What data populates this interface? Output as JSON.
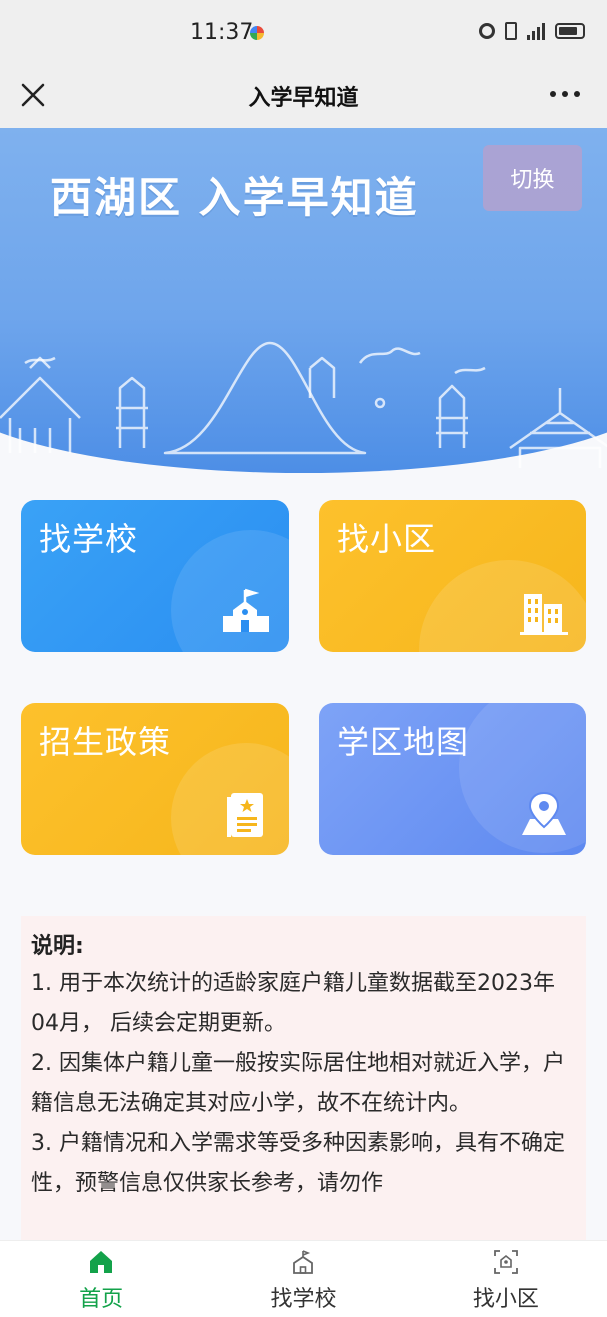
{
  "status_bar": {
    "time": "11:37"
  },
  "nav": {
    "title": "入学早知道"
  },
  "banner": {
    "title": "西湖区 入学早知道",
    "switch_label": "切换"
  },
  "cards": [
    {
      "label": "找学校",
      "icon": "school-icon",
      "color": "#2a8ef1"
    },
    {
      "label": "找小区",
      "icon": "building-icon",
      "color": "#f6b61c"
    },
    {
      "label": "招生政策",
      "icon": "policy-document-icon",
      "color": "#f6b61c"
    },
    {
      "label": "学区地图",
      "icon": "map-pin-icon",
      "color": "#5e89f0"
    }
  ],
  "notice": {
    "title": "说明:",
    "items": [
      "1. 用于本次统计的适龄家庭户籍儿童数据截至2023年04月， 后续会定期更新。",
      "2. 因集体户籍儿童一般按实际居住地相对就近入学，户籍信息无法确定其对应小学，故不在统计内。",
      "3. 户籍情况和入学需求等受多种因素影响，具有不确定性，预警信息仅供家长参考，请勿作"
    ]
  },
  "tabs": [
    {
      "label": "首页",
      "icon": "home-icon",
      "active": true
    },
    {
      "label": "找学校",
      "icon": "school-icon",
      "active": false
    },
    {
      "label": "找小区",
      "icon": "community-scan-icon",
      "active": false
    }
  ],
  "colors": {
    "accent": "#13a24a",
    "banner": "#6ea5ec",
    "notice_bg": "#fcf1f1"
  }
}
